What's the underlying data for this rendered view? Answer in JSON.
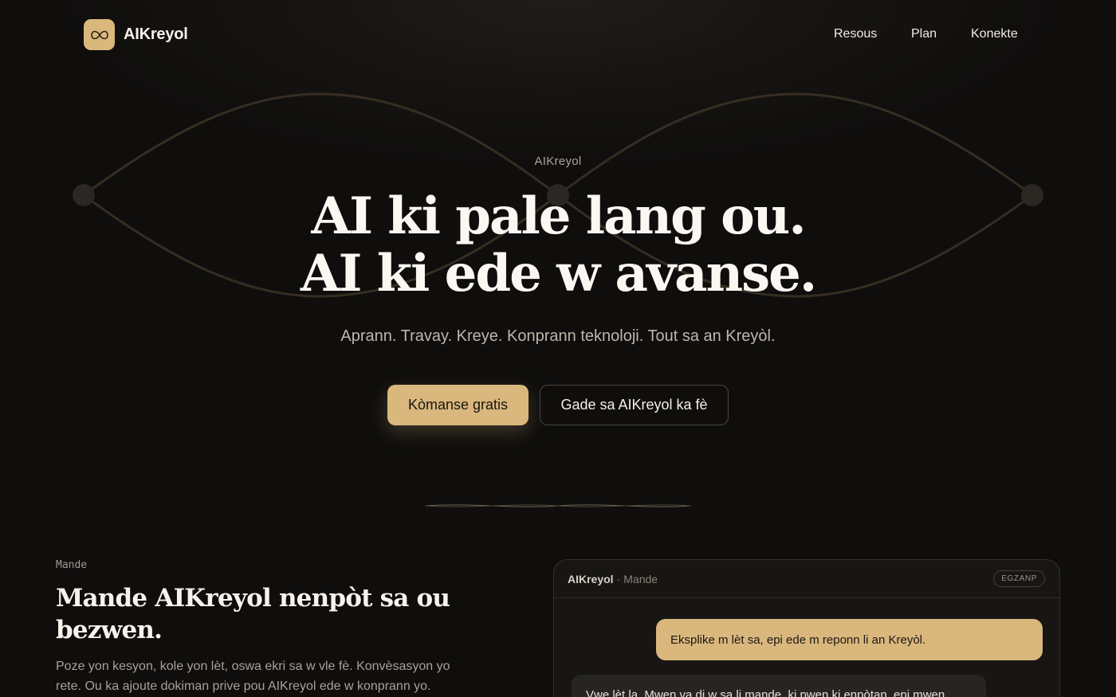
{
  "header": {
    "brand": "AIKreyol",
    "logo_icon": "infinity-icon",
    "accent_color": "#d9b77d",
    "nav": [
      {
        "label": "Resous"
      },
      {
        "label": "Plan"
      },
      {
        "label": "Konekte"
      }
    ]
  },
  "hero": {
    "eyebrow": "AIKreyol",
    "headline_line1": "AI ki pale lang ou.",
    "headline_line2": "AI ki ede w avanse.",
    "subtitle": "Aprann. Travay. Kreye. Konprann teknoloji. Tout sa an Kreyòl.",
    "primary_button": "Kòmanse gratis",
    "secondary_button": "Gade sa AIKreyol ka fè"
  },
  "section": {
    "label": "Mande",
    "title": "Mande AIKreyol nenpòt sa ou bezwen.",
    "description": "Poze yon kesyon, kole yon lèt, oswa ekri sa w vle fè. Konvèsasyon yo rete. Ou ka ajoute dokiman prive pou AIKreyol ede w konprann yo."
  },
  "chat": {
    "app_name": "AIKreyol",
    "separator": "·",
    "mode": "Mande",
    "badge": "EGZANP",
    "user_message": "Eksplike m lèt sa, epi ede m reponn li an Kreyòl.",
    "ai_message": "Vwe lèt la. Mwen va di w sa li mande, ki pwen ki enpòtan, epi mwen"
  }
}
